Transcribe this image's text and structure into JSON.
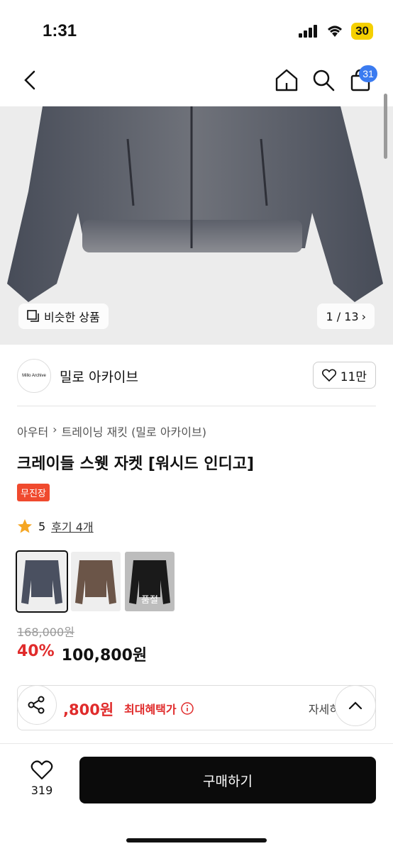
{
  "status": {
    "time": "1:31",
    "battery": "30"
  },
  "nav": {
    "cart_count": "31"
  },
  "hero": {
    "similar_label": "비슷한 상품",
    "page_indicator": "1 / 13"
  },
  "shop": {
    "logo_text": "Millo Archive",
    "name": "밀로 아카이브",
    "likes": "11만"
  },
  "product": {
    "breadcrumb": [
      "아우터",
      "트레이닝 재킷 (밀로 아카이브)"
    ],
    "title": "크레이들 스웻 자켓 [워시드 인디고]",
    "tag": "무진장",
    "rating": "5",
    "reviews": "후기 4개",
    "thumbs": [
      {
        "color": "#4a5060",
        "soldout": ""
      },
      {
        "color": "#6b5548",
        "soldout": ""
      },
      {
        "color": "#1a1a1a",
        "soldout": "품절"
      }
    ],
    "original_price": "168,000원",
    "discount": "40%",
    "sale_price": "100,800원"
  },
  "benefit": {
    "price": ",800원",
    "label": "최대혜택가",
    "detail": "자세히"
  },
  "bottom": {
    "fav_count": "319",
    "buy_label": "구매하기"
  }
}
